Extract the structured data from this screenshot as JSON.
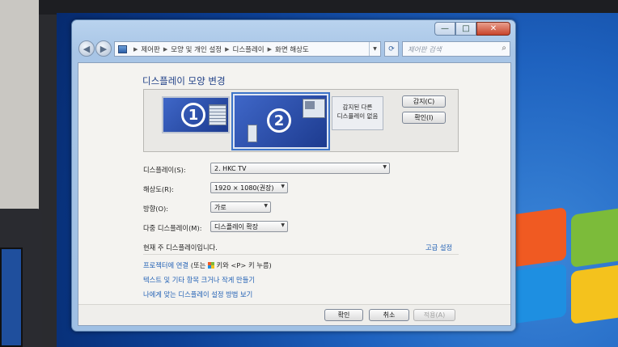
{
  "window": {
    "caption_min": "—",
    "caption_max": "□",
    "caption_close": "✕"
  },
  "nav": {
    "back_glyph": "◀",
    "forward_glyph": "▶",
    "breadcrumbs": [
      "제어판",
      "모양 및 개인 설정",
      "디스플레이",
      "화면 해상도"
    ],
    "search_placeholder": "제어판 검색"
  },
  "page": {
    "title": "디스플레이 모양 변경",
    "monitor1_number": "1",
    "monitor2_number": "2",
    "undetected_text_line1": "감지된 다른",
    "undetected_text_line2": "디스플레이 없음",
    "detect_label": "감지(C)",
    "identify_label": "확인(I)"
  },
  "settings": {
    "display_label": "디스플레이(S):",
    "display_value": "2. HKC TV",
    "resolution_label": "해상도(R):",
    "resolution_value": "1920 × 1080(권장)",
    "orientation_label": "방향(O):",
    "orientation_value": "가로",
    "multi_label": "다중 디스플레이(M):",
    "multi_value": "디스플레이 확장"
  },
  "status": {
    "main_display_text": "현재 주 디스플레이입니다.",
    "advanced_link": "고급 설정"
  },
  "links": {
    "projector_prefix": "프로젝터에 연결",
    "projector_suffix": "(또는",
    "projector_tail": "키와 <P> 키 누름)",
    "text_size": "텍스트 및 기타 항목 크거나 작게 만들기",
    "which_settings": "나에게 맞는 디스플레이 설정 방법 보기"
  },
  "footer": {
    "ok_label": "확인",
    "cancel_label": "취소",
    "apply_label": "적용(A)"
  },
  "colors": {
    "accent_link": "#1f5fb4",
    "title_blue": "#1e3f86",
    "monitor_blue": "#2a4fb0"
  }
}
